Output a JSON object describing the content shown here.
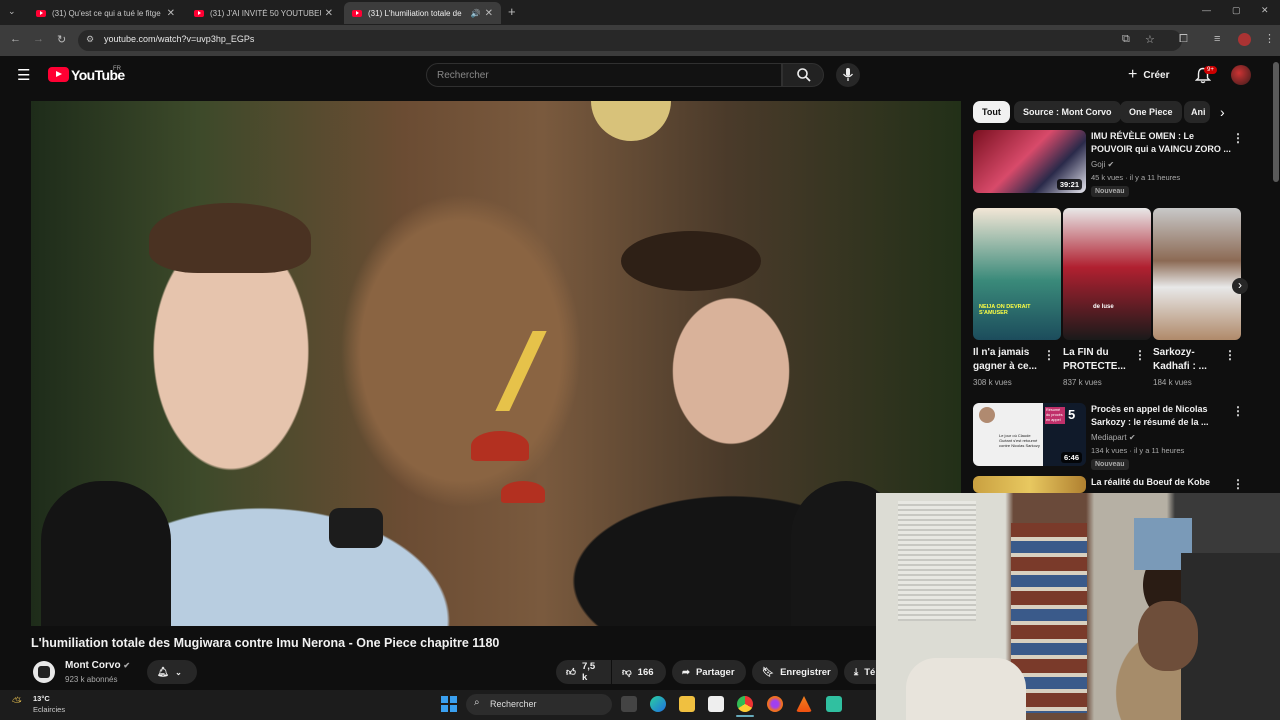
{
  "browser": {
    "tabs": [
      {
        "title": "(31) Qu'est ce qui a tué le fitge"
      },
      {
        "title": "(31) J'AI INVITÉ 50 YOUTUBEUR"
      },
      {
        "title": "(31) L'humiliation totale de"
      }
    ],
    "url": "youtube.com/watch?v=uvp3hp_EGPs"
  },
  "youtube": {
    "logo_text": "YouTube",
    "region": "FR",
    "search_placeholder": "Rechercher",
    "create_label": "Créer",
    "notif_count": "9+"
  },
  "video": {
    "title": "L'humiliation totale des Mugiwara contre Imu Nerona - One Piece chapitre 1180",
    "channel": "Mont Corvo",
    "subscribers": "923 k abonnés",
    "likes": "7,5 k",
    "dislikes": "166",
    "share_label": "Partager",
    "save_label": "Enregistrer",
    "download_label": "Té"
  },
  "sidebar": {
    "chips": [
      "Tout",
      "Source : Mont Corvo",
      "One Piece",
      "Ani"
    ],
    "videos": [
      {
        "title1": "IMU RÉVÈLE OMEN : Le",
        "title2": "POUVOIR qui a VAINCU ZORO ...",
        "channel": "Goji",
        "meta": "45 k vues · il y a 11 heures",
        "duration": "39:21",
        "badge": "Nouveau"
      },
      {
        "title1": "Procès en appel de Nicolas",
        "title2": "Sarkozy : le résumé de la ...",
        "channel": "Mediapart",
        "meta": "134 k vues · il y a 11 heures",
        "duration": "6:46",
        "badge": "Nouveau"
      },
      {
        "title1": "La réalité du Boeuf de Kobe",
        "title2": "",
        "channel": "",
        "meta": "",
        "duration": "",
        "badge": ""
      }
    ],
    "shorts": [
      {
        "title1": "Il n'a jamais",
        "title2": "gagner à ce...",
        "views": "308 k vues",
        "overlay": "NEIJA ON DEVRAIT S'AMUSER"
      },
      {
        "title1": "La FIN du",
        "title2": "PROTECTE...",
        "views": "837 k vues",
        "overlay": "de luse"
      },
      {
        "title1": "Sarkozy-",
        "title2": "Kadhafi : ...",
        "views": "184 k vues",
        "overlay": ""
      }
    ],
    "mediapart_thumb_text1": "Le jour où Claude Guéant s'est retourné contre Nicolas Sarkozy",
    "mediapart_thumb_text2": "Résumé du procès en appel",
    "mediapart_thumb_num": "5"
  },
  "taskbar": {
    "weather_temp": "13°C",
    "weather_desc": "Eclaircies",
    "search_label": "Rechercher"
  }
}
